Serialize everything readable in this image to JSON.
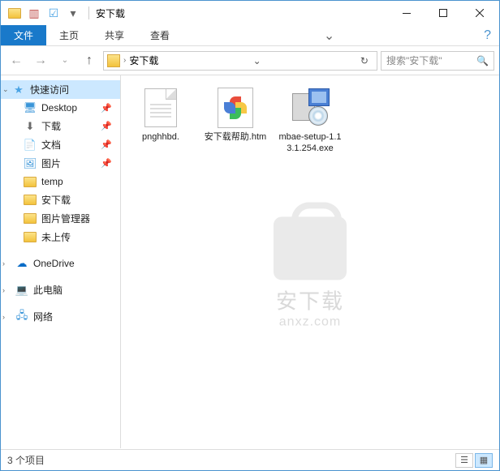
{
  "window": {
    "title": "安下载"
  },
  "ribbon": {
    "tabs": {
      "file": "文件",
      "home": "主页",
      "share": "共享",
      "view": "查看"
    }
  },
  "address": {
    "path": "安下载",
    "search_placeholder": "搜索\"安下载\""
  },
  "sidebar": {
    "quick_access": "快速访问",
    "items": [
      {
        "label": "Desktop",
        "pinned": true
      },
      {
        "label": "下载",
        "pinned": true
      },
      {
        "label": "文档",
        "pinned": true
      },
      {
        "label": "图片",
        "pinned": true
      },
      {
        "label": "temp",
        "pinned": false
      },
      {
        "label": "安下载",
        "pinned": false
      },
      {
        "label": "图片管理器",
        "pinned": false
      },
      {
        "label": "未上传",
        "pinned": false
      }
    ],
    "onedrive": "OneDrive",
    "this_pc": "此电脑",
    "network": "网络"
  },
  "files": [
    {
      "name": "pnghhbd.",
      "type": "generic"
    },
    {
      "name": "安下载帮助.htm",
      "type": "htm"
    },
    {
      "name": "mbae-setup-1.13.1.254.exe",
      "type": "exe"
    }
  ],
  "status": {
    "count_text": "3 个项目"
  },
  "watermark": {
    "line1": "安下载",
    "line2": "anxz.com"
  }
}
